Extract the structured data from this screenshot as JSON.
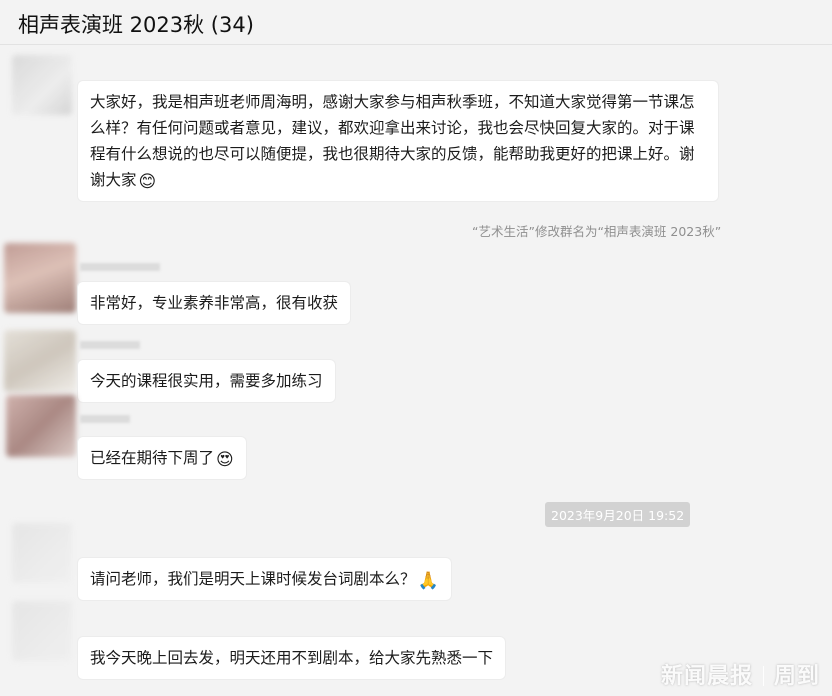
{
  "window": {
    "title": "相声表演班 2023秋 (34)"
  },
  "messages": {
    "m1": "大家好，我是相声班老师周海明，感谢大家参与相声秋季班，不知道大家觉得第一节课怎么样？有任何问题或者意见，建议，都欢迎拿出来讨论，我也会尽快回复大家的。对于课程有什么想说的也尽可以随便提，我也很期待大家的反馈，能帮助我更好的把课上好。谢谢大家",
    "m1_emoji": "😊",
    "system_notice": "“艺术生活”修改群名为“相声表演班 2023秋”",
    "m2": "非常好，专业素养非常高，很有收获",
    "m3": "今天的课程很实用，需要多加练习",
    "m4": "已经在期待下周了",
    "m4_emoji": "😍",
    "timestamp": "2023年9月20日 19:52",
    "m5": "请问老师，我们是明天上课时候发台词剧本么？",
    "m5_emoji": "🙏",
    "m6": "我今天晚上回去发，明天还用不到剧本，给大家先熟悉一下"
  },
  "watermark": {
    "left": "新闻晨报",
    "right": "周到"
  }
}
